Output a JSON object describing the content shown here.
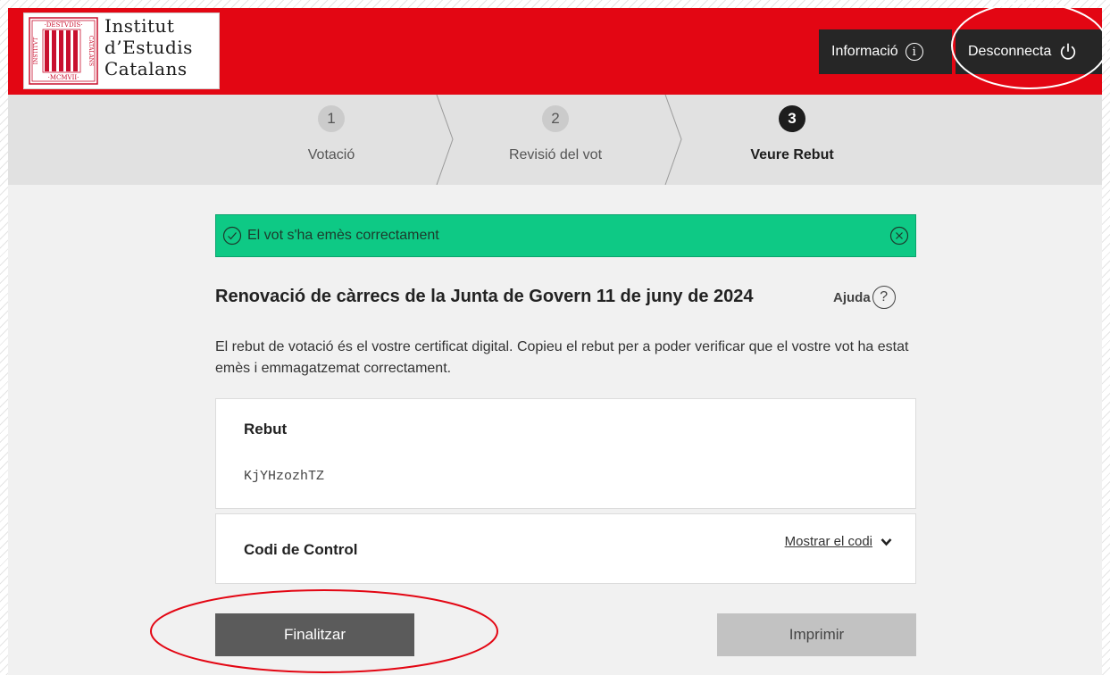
{
  "header": {
    "logo": {
      "line1": "Institut",
      "line2": "d’Estudis",
      "line3": "Catalans",
      "seal_text_top": "·DESTVDIS·",
      "seal_text_bottom": "·MCMVII·",
      "seal_text_left": "INSTITVT",
      "seal_text_right": "CATALANS"
    },
    "info_label": "Informació",
    "info_icon": "info-icon",
    "logout_label": "Desconnecta",
    "logout_icon": "power-icon",
    "brand_color": "#e30613"
  },
  "steps": [
    {
      "number": "1",
      "label": "Votació"
    },
    {
      "number": "2",
      "label": "Revisió del vot"
    },
    {
      "number": "3",
      "label": "Veure Rebut"
    }
  ],
  "alert": {
    "text": "El vot s'ha emès correctament",
    "color": "#0ec985"
  },
  "election": {
    "title": "Renovació de càrrecs de la Junta de Govern 11 de juny de 2024",
    "help_label": "Ajuda",
    "description": "El rebut de votació és el vostre certificat digital. Copieu el rebut per a poder verificar que el vostre vot ha estat emès i emmagatzemat correctament."
  },
  "receipt": {
    "label": "Rebut",
    "code": "KjYHzozhTZ"
  },
  "control": {
    "label": "Codi de Control",
    "show_label": "Mostrar el codi"
  },
  "buttons": {
    "finish": "Finalitzar",
    "print": "Imprimir"
  }
}
